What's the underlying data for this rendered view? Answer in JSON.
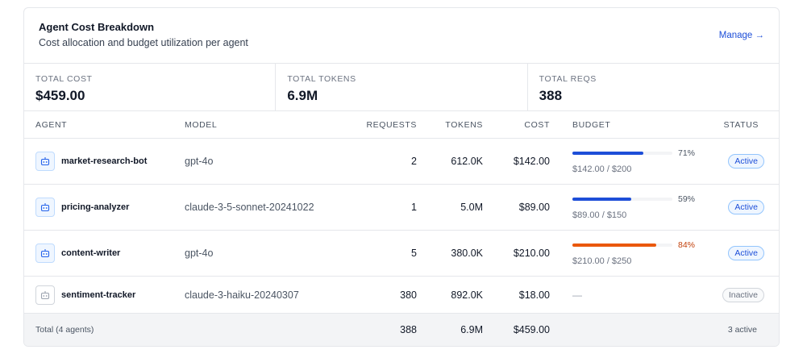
{
  "header": {
    "title": "Agent Cost Breakdown",
    "subtitle": "Cost allocation and budget utilization per agent",
    "manage_label": "Manage →"
  },
  "stats": [
    {
      "label": "TOTAL COST",
      "value": "$459.00"
    },
    {
      "label": "TOTAL TOKENS",
      "value": "6.9M"
    },
    {
      "label": "TOTAL REQS",
      "value": "388"
    }
  ],
  "table": {
    "columns": {
      "agent": "AGENT",
      "model": "MODEL",
      "requests": "REQUESTS",
      "tokens": "TOKENS",
      "cost": "COST",
      "budget": "BUDGET",
      "status": "STATUS"
    },
    "rows": [
      {
        "agent": "market-research-bot",
        "model": "gpt-4o",
        "requests": "2",
        "tokens": "612.0K",
        "cost": "$142.00",
        "budget_pct": "71%",
        "budget_fraction": 0.71,
        "budget_text": "$142.00 / $200",
        "status": "Active",
        "icon": "bot-icon"
      },
      {
        "agent": "pricing-analyzer",
        "model": "claude-3-5-sonnet-20241022",
        "requests": "1",
        "tokens": "5.0M",
        "cost": "$89.00",
        "budget_pct": "59%",
        "budget_fraction": 0.59,
        "budget_text": "$89.00 / $150",
        "status": "Active",
        "icon": "bot-icon"
      },
      {
        "agent": "content-writer",
        "model": "gpt-4o",
        "requests": "5",
        "tokens": "380.0K",
        "cost": "$210.00",
        "budget_pct": "84%",
        "budget_fraction": 0.84,
        "budget_text": "$210.00 / $250",
        "status": "Active",
        "icon": "bot-icon"
      },
      {
        "agent": "sentiment-tracker",
        "model": "claude-3-haiku-20240307",
        "requests": "380",
        "tokens": "892.0K",
        "cost": "$18.00",
        "budget_dash": "—",
        "status": "Inactive",
        "icon": "bot-icon"
      }
    ],
    "footer": {
      "label": "Total (4 agents)",
      "requests": "388",
      "tokens": "6.9M",
      "cost": "$459.00",
      "status": "3 active"
    }
  },
  "colors": {
    "accent": "#1d4ed8",
    "bar_normal": "#1d4ed8",
    "bar_warning": "#ea580c",
    "warning_text": "#c2410c"
  }
}
